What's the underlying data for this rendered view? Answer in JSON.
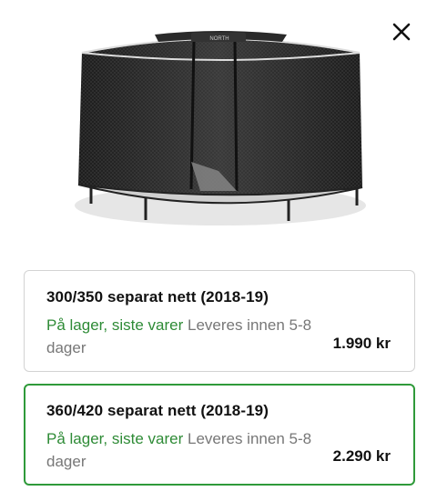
{
  "dialog": {
    "close_icon": "close-icon"
  },
  "product_image": {
    "alt": "Trampoline safety net",
    "brand": "NORTH"
  },
  "variants": [
    {
      "title": "300/350 separat nett (2018-19)",
      "stock_status": "På lager, siste varer",
      "delivery_text": "Leveres innen 5-8 dager",
      "price": "1.990 kr",
      "selected": false
    },
    {
      "title": "360/420 separat nett (2018-19)",
      "stock_status": "På lager, siste varer",
      "delivery_text": "Leveres innen 5-8 dager",
      "price": "2.290 kr",
      "selected": true
    }
  ],
  "colors": {
    "selected_border": "#2f9a3a",
    "stock_green": "#2e8b36",
    "muted_text": "#777777",
    "card_border": "#d3d3d3"
  }
}
